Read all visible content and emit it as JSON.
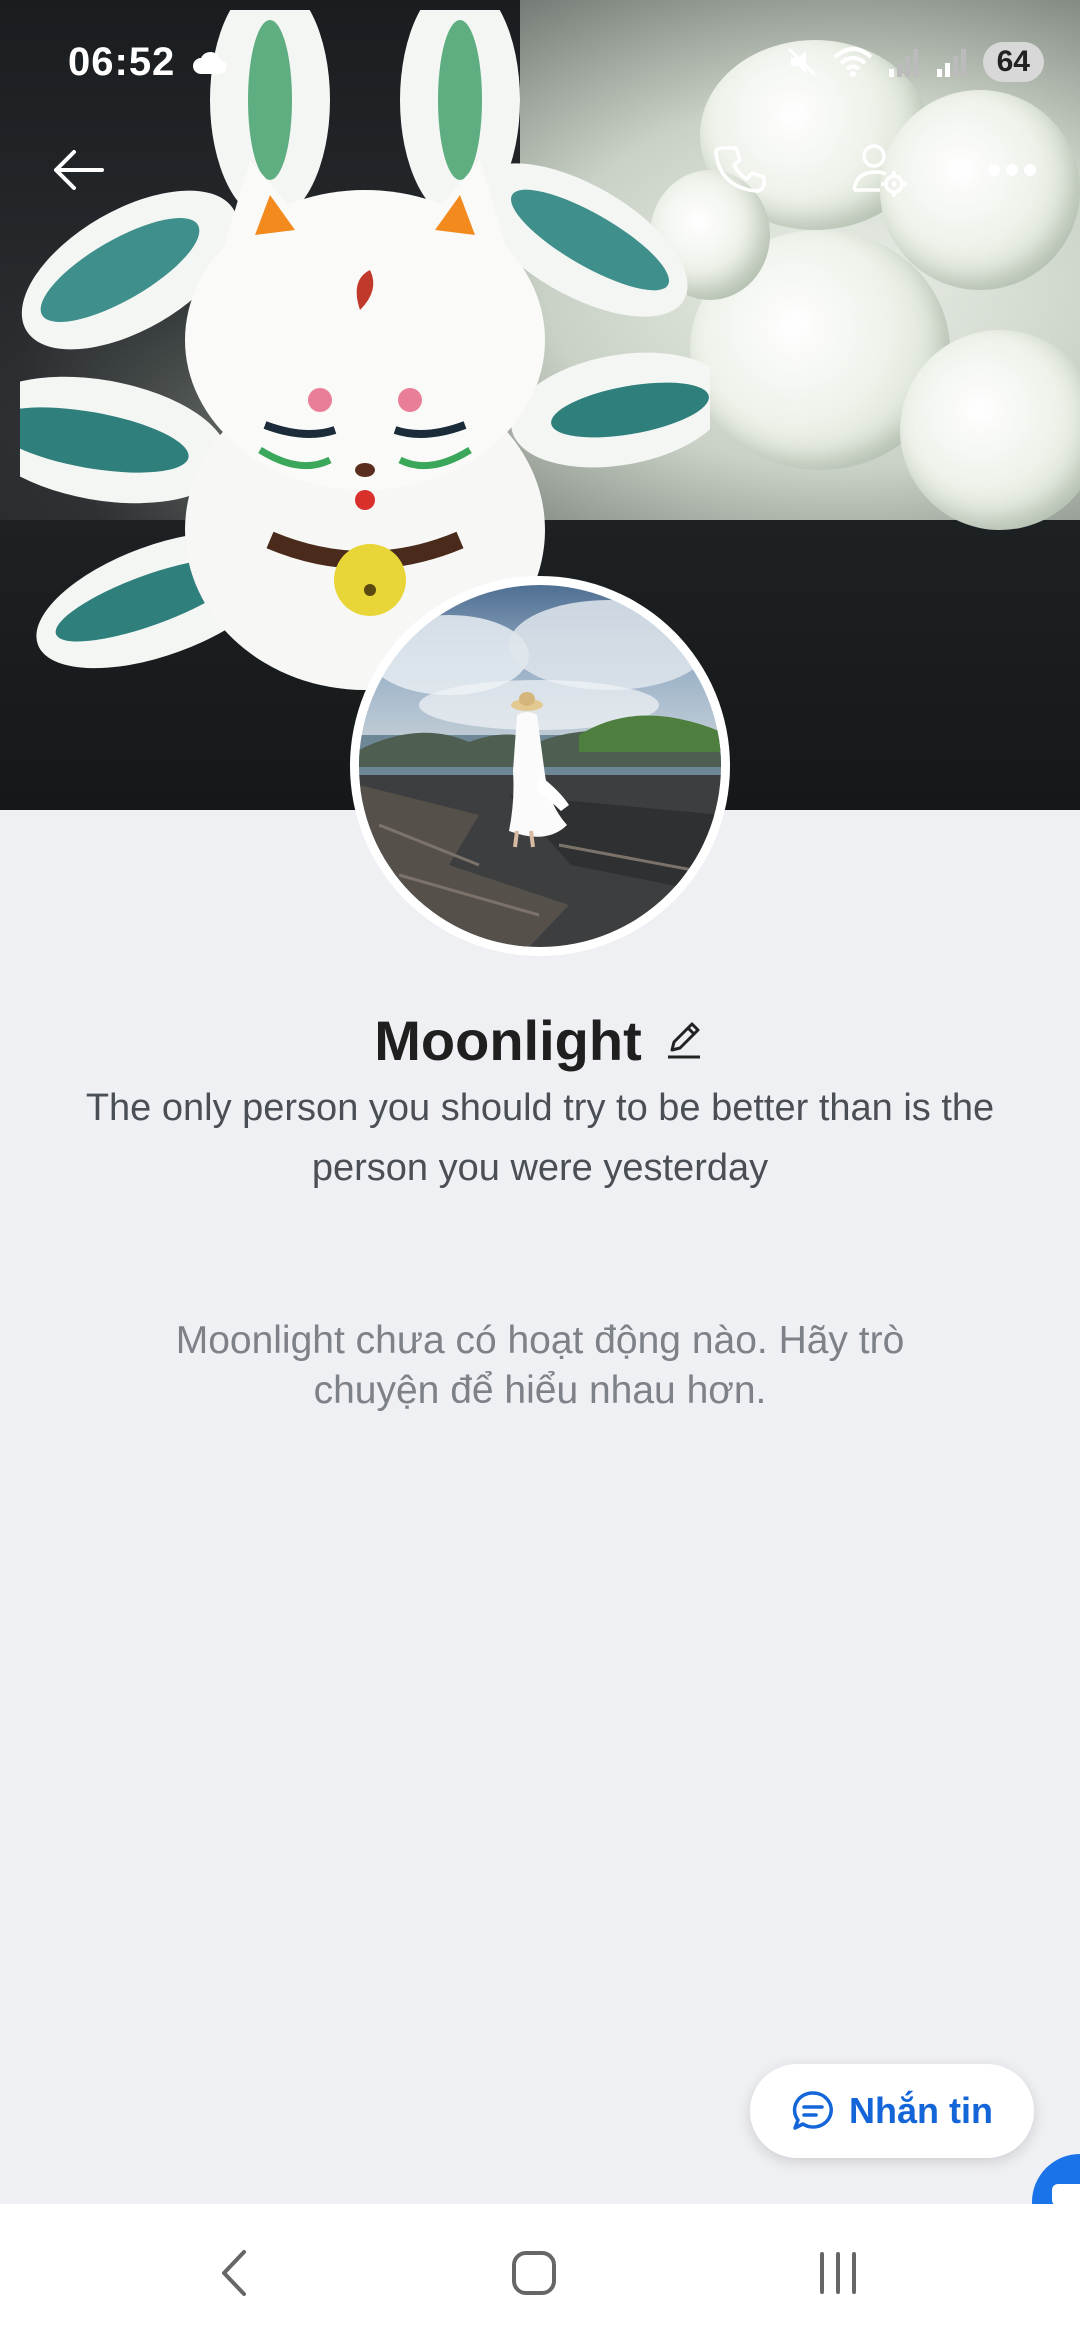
{
  "status_bar": {
    "time": "06:52",
    "battery": "64",
    "icons": [
      "cloud-icon",
      "mute-icon",
      "wifi-icon",
      "signal-icon",
      "signal-icon"
    ]
  },
  "topbar": {
    "icons": [
      "back-arrow-icon",
      "phone-icon",
      "profile-settings-icon",
      "more-icon"
    ]
  },
  "profile": {
    "name": "Moonlight",
    "bio": "The only person you should try to be better than is the person you were yesterday",
    "empty_activity": "Moonlight chưa có hoạt động nào. Hãy trò chuyện để hiểu nhau hơn."
  },
  "actions": {
    "message_label": "Nhắn tin"
  },
  "colors": {
    "accent": "#1465d8",
    "background": "#eff0f4"
  }
}
